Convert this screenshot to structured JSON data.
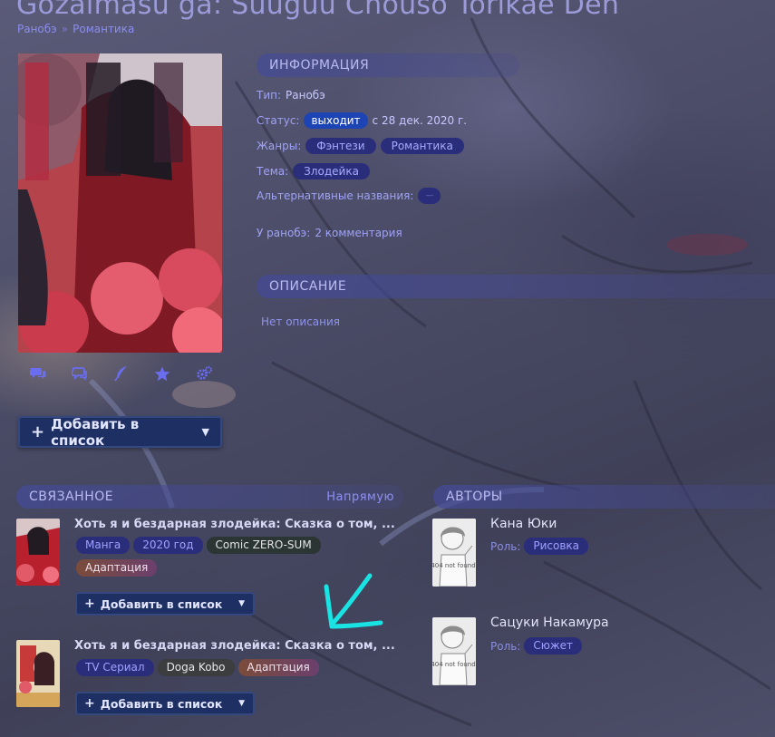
{
  "page": {
    "title": "Gozaimasu ga: Suuguu Chouso Torikae Den",
    "breadcrumb": [
      "Ранобэ",
      "Романтика"
    ],
    "breadcrumb_sep": "»"
  },
  "cover_icons": [
    "comments-icon",
    "chat-icon",
    "quill-icon",
    "star-icon",
    "gears-icon"
  ],
  "add_list_label": "Добавить в список",
  "info": {
    "header": "ИНФОРМАЦИЯ",
    "type_label": "Тип:",
    "type_value": "Ранобэ",
    "status_label": "Статус:",
    "status_value": "выходит",
    "status_since": "с 28 дек. 2020 г.",
    "genres_label": "Жанры:",
    "genres": [
      "Фэнтези",
      "Романтика"
    ],
    "theme_label": "Тема:",
    "themes": [
      "Злодейка"
    ],
    "alt_names_label": "Альтернативные названия:",
    "alt_names_value": "—",
    "comments_prefix": "У ранобэ:",
    "comments_link": "2 комментария"
  },
  "description": {
    "header": "ОПИСАНИЕ",
    "text": "Нет описания"
  },
  "related": {
    "header": "СВЯЗАННОЕ",
    "mode": "Напрямую",
    "items": [
      {
        "title": "Хоть я и бездарная злодейка: Сказка о том, ...",
        "tags": [
          "Манга",
          "2020 год",
          "Comic ZERO-SUM",
          "Адаптация"
        ],
        "add_label": "Добавить в список"
      },
      {
        "title": "Хоть я и бездарная злодейка: Сказка о том, ...",
        "tags": [
          "TV Сериал",
          "Doga Kobo",
          "Адаптация"
        ],
        "add_label": "Добавить в список"
      }
    ]
  },
  "authors": {
    "header": "АВТОРЫ",
    "role_label": "Роль:",
    "items": [
      {
        "name": "Кана Юки",
        "role": "Рисовка"
      },
      {
        "name": "Сацуки Накамура",
        "role": "Сюжет"
      }
    ],
    "placeholder_text": "404 not found"
  },
  "colors": {
    "accent": "#6a6df0",
    "button_bg": "#1e2f63",
    "status_pill": "#1d44b5",
    "annotation_arrow": "#19e3e3"
  }
}
